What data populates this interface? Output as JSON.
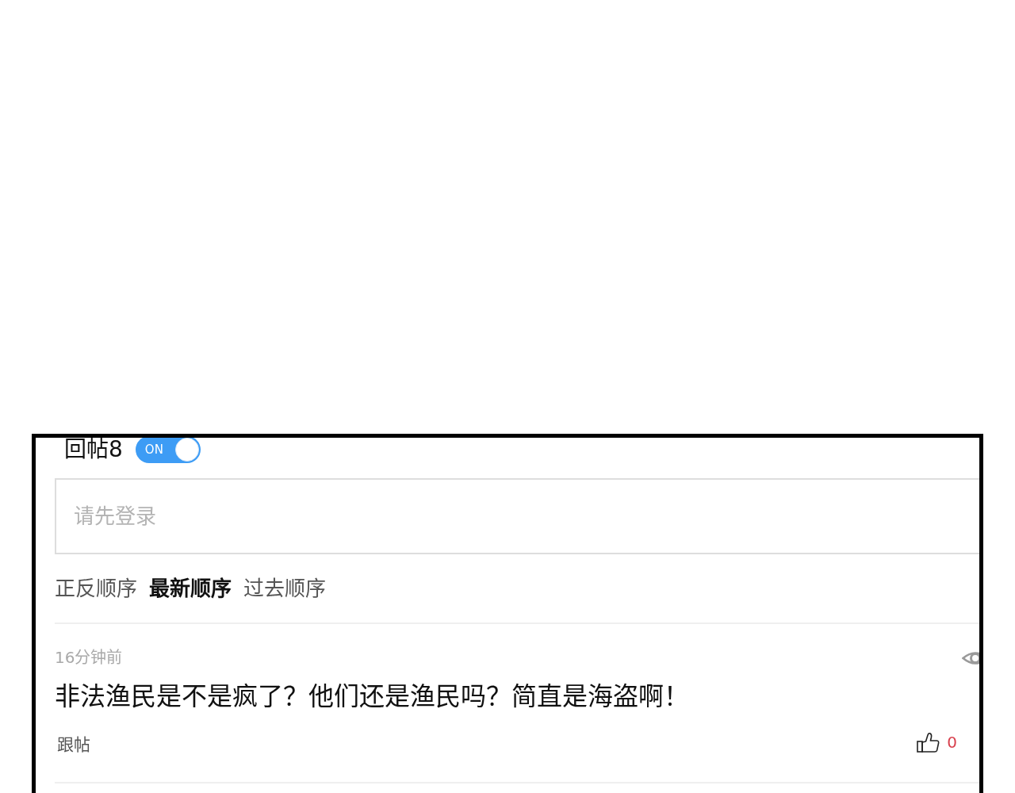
{
  "reply_header": {
    "title": "回帖8",
    "toggle": {
      "label": "ON",
      "on": true
    }
  },
  "comment_box": {
    "placeholder": "请先登录"
  },
  "sort_options": [
    {
      "label": "正反顺序",
      "selected": false
    },
    {
      "label": "最新顺序",
      "selected": true
    },
    {
      "label": "过去顺序",
      "selected": false
    }
  ],
  "comments": [
    {
      "time": "16分钟前",
      "text": "非法渔民是不是疯了？他们还是渔民吗？简直是海盗啊！",
      "reply_label": "跟帖",
      "likes": "0"
    }
  ]
}
